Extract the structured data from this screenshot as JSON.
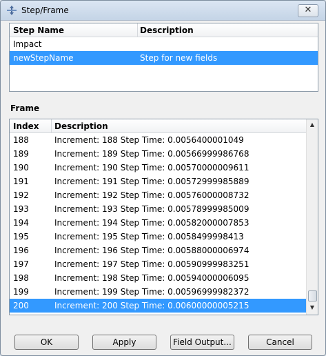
{
  "window": {
    "title": "Step/Frame",
    "close_label": "✕"
  },
  "steps": {
    "columns": [
      "Step Name",
      "Description"
    ],
    "rows": [
      {
        "name": "Impact",
        "description": "",
        "selected": false
      },
      {
        "name": "newStepName",
        "description": "Step for new fields",
        "selected": true
      }
    ]
  },
  "frame": {
    "label": "Frame",
    "columns": [
      "Index",
      "Description"
    ],
    "rows": [
      {
        "index": "188",
        "description": "Increment: 188 Step Time: 0.0056400001049",
        "selected": false
      },
      {
        "index": "189",
        "description": "Increment: 189 Step Time: 0.00566999986768",
        "selected": false
      },
      {
        "index": "190",
        "description": "Increment: 190 Step Time: 0.00570000009611",
        "selected": false
      },
      {
        "index": "191",
        "description": "Increment: 191 Step Time: 0.00572999985889",
        "selected": false
      },
      {
        "index": "192",
        "description": "Increment: 192 Step Time: 0.00576000008732",
        "selected": false
      },
      {
        "index": "193",
        "description": "Increment: 193 Step Time: 0.00578999985009",
        "selected": false
      },
      {
        "index": "194",
        "description": "Increment: 194 Step Time: 0.00582000007853",
        "selected": false
      },
      {
        "index": "195",
        "description": "Increment: 195 Step Time: 0.0058499998413",
        "selected": false
      },
      {
        "index": "196",
        "description": "Increment: 196 Step Time: 0.00588000006974",
        "selected": false
      },
      {
        "index": "197",
        "description": "Increment: 197 Step Time: 0.00590999983251",
        "selected": false
      },
      {
        "index": "198",
        "description": "Increment: 198 Step Time: 0.00594000006095",
        "selected": false
      },
      {
        "index": "199",
        "description": "Increment: 199 Step Time: 0.00596999982372",
        "selected": false
      },
      {
        "index": "200",
        "description": "Increment: 200 Step Time: 0.00600000005215",
        "selected": true
      }
    ]
  },
  "buttons": {
    "ok": "OK",
    "apply": "Apply",
    "field_output": "Field Output...",
    "cancel": "Cancel"
  },
  "colors": {
    "selection": "#3399ff"
  },
  "icons": {
    "title": "step-frame-icon",
    "scroll_up": "arrow-up-icon",
    "scroll_down": "arrow-down-icon"
  }
}
